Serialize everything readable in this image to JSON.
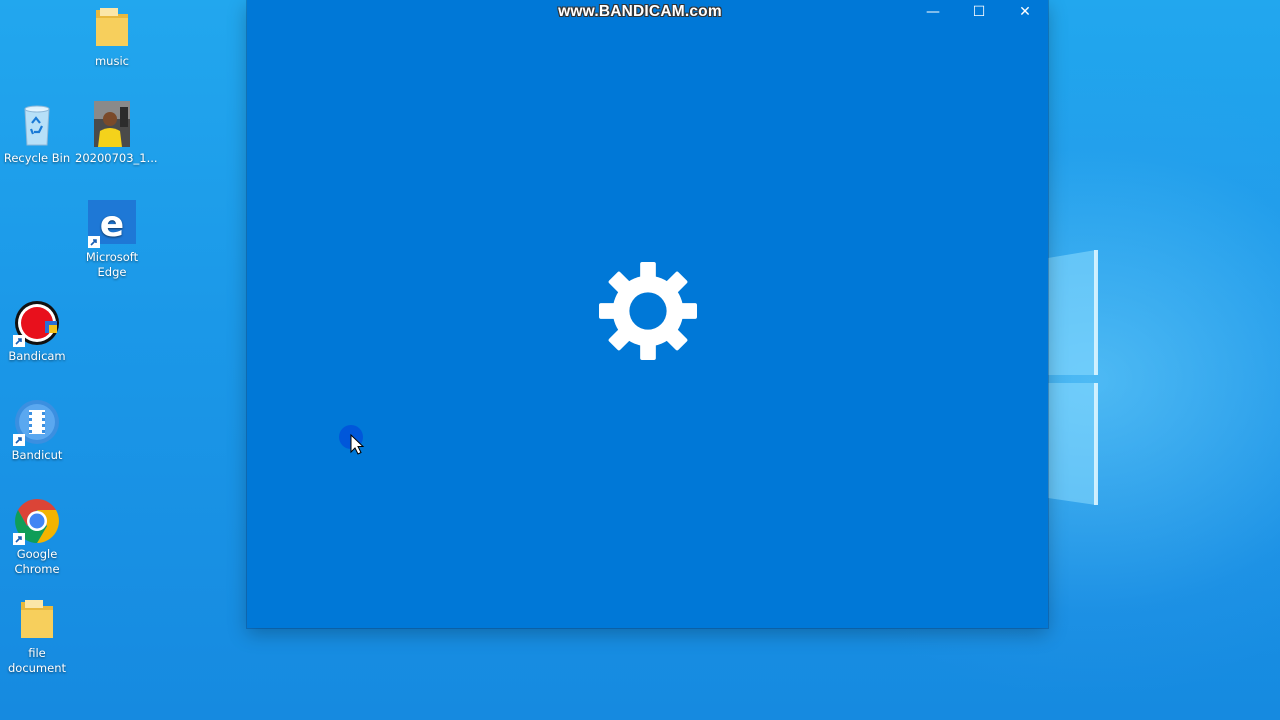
{
  "watermark": "www.BANDICAM.com",
  "desktop": {
    "icons": [
      {
        "label": "music",
        "icon": "folder-icon"
      },
      {
        "label": "Recycle Bin",
        "icon": "recycle-bin-icon"
      },
      {
        "label": "20200703_1...",
        "icon": "photo-thumbnail-icon"
      },
      {
        "label": "Microsoft Edge",
        "icon": "edge-icon"
      },
      {
        "label": "Bandicam",
        "icon": "bandicam-icon"
      },
      {
        "label": "Bandicut",
        "icon": "bandicut-icon"
      },
      {
        "label": "Google Chrome",
        "icon": "chrome-icon"
      },
      {
        "label": "file document",
        "icon": "folder-icon"
      }
    ]
  },
  "window": {
    "minimize": "—",
    "maximize": "☐",
    "close": "✕",
    "splash_icon": "gear-icon",
    "background_color": "#0078d7"
  },
  "colors": {
    "wallpaper": "#1b98e8",
    "window": "#0078d7",
    "folder": "#f7cf5c",
    "edge": "#1e78d6",
    "bandicam_red": "#e8101c"
  }
}
